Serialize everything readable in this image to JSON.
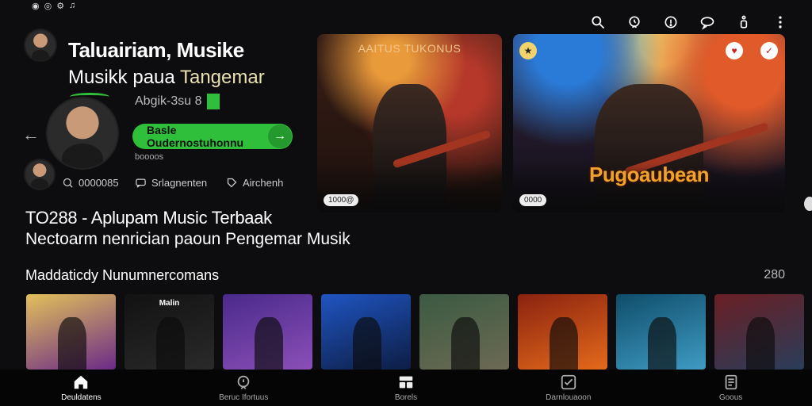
{
  "header": {
    "title_line1": "Taluairiam, Musike",
    "title_line2_plain": "Musikk paua ",
    "title_line2_accent": "Tangemar",
    "subline": "Abgik-3su 8"
  },
  "cta": {
    "label": "Basle Oudernostuhonnu",
    "arrow": "→"
  },
  "cta_caption": "boooos",
  "meta": [
    {
      "icon": "globe-icon",
      "text": "0000085"
    },
    {
      "icon": "chat-icon",
      "text": "Srlagnenten"
    },
    {
      "icon": "tag-icon",
      "text": "Airchenh"
    }
  ],
  "headline": {
    "line1": "TO288 - Aplupam Music Terbaak",
    "line2": "Nectoarm nenrician paoun Pengemar Musik"
  },
  "hero_cards": [
    {
      "title": "AAITUS TUKONUS",
      "badge": "1000@"
    },
    {
      "title": "",
      "big_word": "Pugoaubean",
      "badge": "0000"
    }
  ],
  "section": {
    "title": "Maddaticdy Nunumnercomans",
    "count": "280"
  },
  "thumbs": [
    {
      "title": "",
      "colors": [
        "#e2c15a",
        "#6a2a88"
      ]
    },
    {
      "title": "Malin",
      "colors": [
        "#121212",
        "#2a2a2a"
      ]
    },
    {
      "title": "",
      "colors": [
        "#4a2a8a",
        "#8b4fb8"
      ]
    },
    {
      "title": "",
      "colors": [
        "#1f55c2",
        "#0d1d44"
      ]
    },
    {
      "title": "",
      "colors": [
        "#3b5a42",
        "#6d6a54"
      ]
    },
    {
      "title": "",
      "colors": [
        "#8a2210",
        "#e46a1b"
      ]
    },
    {
      "title": "",
      "colors": [
        "#0f4d6a",
        "#3f9bc4"
      ]
    },
    {
      "title": "",
      "colors": [
        "#6a1f24",
        "#2a3d5a"
      ]
    }
  ],
  "status_icons": [
    "whatsapp-icon",
    "camera-icon",
    "settings-icon",
    "music-icon"
  ],
  "top_icons": [
    "search-icon",
    "bell-icon",
    "account-icon",
    "chat-icon",
    "info-icon",
    "more-icon"
  ],
  "nav": [
    {
      "label": "Deuldatens",
      "icon": "home-icon",
      "active": true
    },
    {
      "label": "Beruc Ifortuus",
      "icon": "search-icon",
      "active": false
    },
    {
      "label": "Borels",
      "icon": "library-icon",
      "active": false
    },
    {
      "label": "Darnlouaoon",
      "icon": "check-icon",
      "active": false
    },
    {
      "label": "Goous",
      "icon": "profile-icon",
      "active": false
    }
  ],
  "colors": {
    "accent": "#2fbf3a",
    "background": "#0d0d0f"
  }
}
